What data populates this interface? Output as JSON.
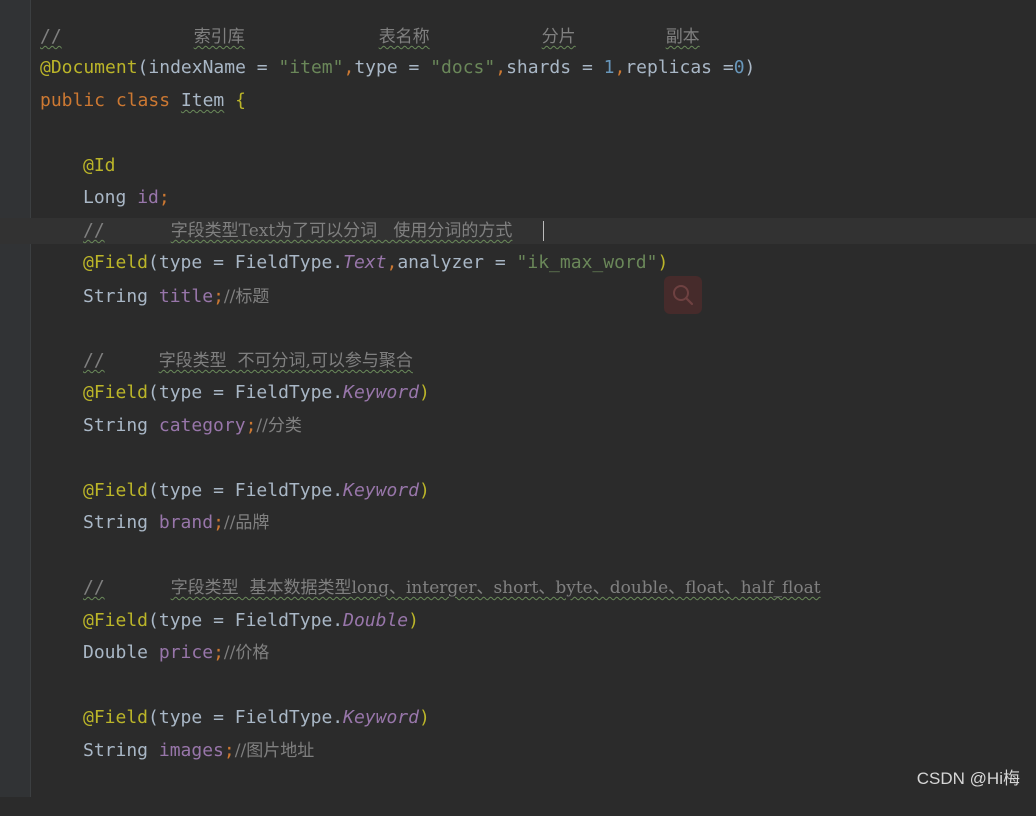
{
  "code": {
    "line1": {
      "slashes": "//",
      "index_lib": "索引库",
      "table_name": "表名称",
      "shards_cn": "分片",
      "replicas_cn": "副本"
    },
    "line2": {
      "annotation": "@Document",
      "open": "(",
      "p1": "indexName",
      "eq1": " = ",
      "v1": "\"item\"",
      "c1": ",",
      "p2": "type",
      "eq2": " = ",
      "v2": "\"docs\"",
      "c2": ",",
      "p3": "shards",
      "eq3": " = ",
      "v3": "1",
      "c3": ",",
      "p4": "replicas",
      "eq4": " =",
      "v4": "0",
      "close": ")"
    },
    "line3": {
      "kw_public": "public",
      "kw_class": "class",
      "classname": "Item",
      "brace": "{"
    },
    "id_block": {
      "annotation": "@Id",
      "type": "Long",
      "name": "id",
      "semi": ";"
    },
    "title_block": {
      "comment_slashes": "//",
      "comment_text": "字段类型Text为了可以分词   使用分词的方式",
      "annotation": "@Field",
      "open": "(",
      "param": "type",
      "eq": " = ",
      "enum_class": "FieldType.",
      "enum_value": "Text",
      "comma": ",",
      "param2": "analyzer",
      "eq2": " = ",
      "value2": "\"ik_max_word\"",
      "close": ")",
      "type": "String",
      "name": "title",
      "semi": ";",
      "trailing_comment": "//标题"
    },
    "category_block": {
      "comment_slashes": "//",
      "comment_text": "字段类型  不可分词,可以参与聚合",
      "annotation": "@Field",
      "open": "(",
      "param": "type",
      "eq": " = ",
      "enum_class": "FieldType.",
      "enum_value": "Keyword",
      "close": ")",
      "type": "String",
      "name": "category",
      "semi": ";",
      "trailing_comment": "//分类"
    },
    "brand_block": {
      "annotation": "@Field",
      "open": "(",
      "param": "type",
      "eq": " = ",
      "enum_class": "FieldType.",
      "enum_value": "Keyword",
      "close": ")",
      "type": "String",
      "name": "brand",
      "semi": ";",
      "trailing_comment": "//品牌"
    },
    "price_block": {
      "comment_slashes": "//",
      "comment_text": "字段类型  基本数据类型long、interger、short、byte、double、float、half_float",
      "annotation": "@Field",
      "open": "(",
      "param": "type",
      "eq": " = ",
      "enum_class": "FieldType.",
      "enum_value": "Double",
      "close": ")",
      "type": "Double",
      "name": "price",
      "semi": ";",
      "trailing_comment": "//价格"
    },
    "images_block": {
      "annotation": "@Field",
      "open": "(",
      "param": "type",
      "eq": " = ",
      "enum_class": "FieldType.",
      "enum_value": "Keyword",
      "close": ")",
      "type": "String",
      "name": "images",
      "semi": ";",
      "trailing_comment": "//图片地址"
    }
  },
  "search_icon": "search-icon",
  "watermark": "CSDN @Hi梅",
  "colors": {
    "background": "#2b2b2b",
    "keyword": "#cc7832",
    "annotation": "#bbb529",
    "string": "#6a8759",
    "number": "#6897bb",
    "field": "#9876aa",
    "comment": "#808080",
    "text": "#a9b7c6"
  }
}
